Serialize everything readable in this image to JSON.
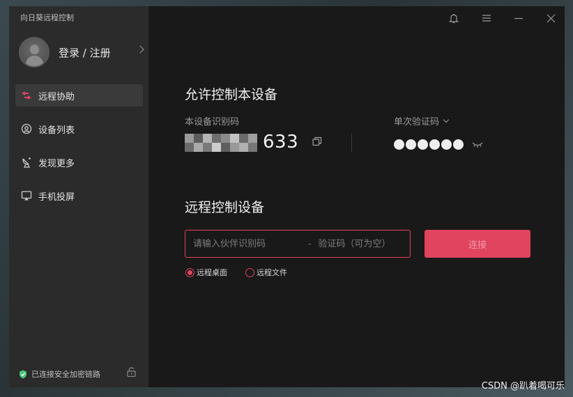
{
  "app": {
    "title": "向日葵远程控制"
  },
  "user": {
    "login_label": "登录 / 注册"
  },
  "sidebar": {
    "items": [
      {
        "label": "远程协助",
        "icon": "remote-assist-icon",
        "active": true
      },
      {
        "label": "设备列表",
        "icon": "device-list-icon",
        "active": false
      },
      {
        "label": "发现更多",
        "icon": "discover-icon",
        "active": false
      },
      {
        "label": "手机投屏",
        "icon": "screen-cast-icon",
        "active": false
      }
    ],
    "footer_status": "已连接安全加密链路"
  },
  "allow_control": {
    "title": "允许控制本设备",
    "device_id_label": "本设备识别码",
    "device_id_visible": "633",
    "code_label": "单次验证码"
  },
  "remote_control": {
    "title": "远程控制设备",
    "id_placeholder": "请输入伙伴识别码",
    "separator": "-",
    "code_placeholder": "验证码（可为空）",
    "connect_label": "连接",
    "options": [
      {
        "label": "远程桌面",
        "checked": true
      },
      {
        "label": "远程文件",
        "checked": false
      }
    ]
  },
  "watermark": "CSDN @趴着喝可乐",
  "colors": {
    "accent": "#e0445f",
    "sidebar_bg": "#2b2b2b",
    "main_bg": "#191919",
    "secure_green": "#4cc27a"
  }
}
